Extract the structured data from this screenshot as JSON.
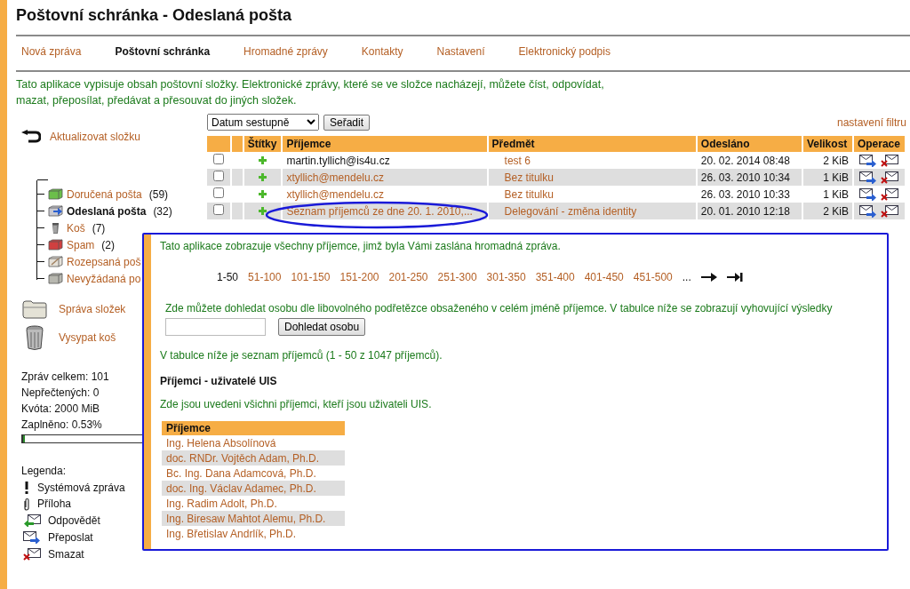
{
  "title": "Poštovní schránka - Odeslaná pošta",
  "nav": [
    {
      "label": "Nová zpráva",
      "selected": false
    },
    {
      "label": "Poštovní schránka",
      "selected": true
    },
    {
      "label": "Hromadné zprávy",
      "selected": false
    },
    {
      "label": "Kontakty",
      "selected": false
    },
    {
      "label": "Nastavení",
      "selected": false
    },
    {
      "label": "Elektronický podpis",
      "selected": false
    }
  ],
  "intro": "Tato aplikace vypisuje obsah poštovní složky. Elektronické zprávy, které se ve složce nacházejí, můžete číst, odpovídat, mazat, přeposílat, předávat a přesouvat do jiných složek.",
  "sidebar": {
    "refresh": "Aktualizovat složku",
    "folders": [
      {
        "kind": "inbox",
        "name": "Doručená pošta",
        "count": "(59)",
        "selected": false
      },
      {
        "kind": "sent",
        "name": "Odeslaná pošta",
        "count": "(32)",
        "selected": true
      },
      {
        "kind": "trash",
        "name": "Koš",
        "count": "(7)",
        "selected": false
      },
      {
        "kind": "spam",
        "name": "Spam",
        "count": "(2)",
        "selected": false
      },
      {
        "kind": "drafts",
        "name": "Rozepsaná poš",
        "selected": false
      },
      {
        "kind": "junk",
        "name": "Nevyžádaná po",
        "selected": false
      }
    ],
    "actions": [
      {
        "kind": "folder",
        "label": "Správa složek"
      },
      {
        "kind": "trash",
        "label": "Vysypat koš"
      }
    ],
    "stats": [
      "Zpráv celkem: 101",
      "Nepřečtených: 0",
      "Kvóta: 2000 MiB",
      "Zaplněno: 0.53%"
    ],
    "usage": {
      "level": 0.0053
    },
    "legend_title": "Legenda:",
    "legend": [
      {
        "kind": "system",
        "label": "Systémová zpráva"
      },
      {
        "kind": "attachment",
        "label": "Příloha"
      },
      {
        "kind": "reply",
        "label": "Odpovědět"
      },
      {
        "kind": "forward",
        "label": "Přeposlat"
      },
      {
        "kind": "delete",
        "label": "Smazat"
      }
    ]
  },
  "sort": {
    "value": "Datum sestupně",
    "button": "Seřadit"
  },
  "filter_link": "nastavení filtru",
  "table": {
    "columns": [
      "Štítky",
      "Příjemce",
      "Předmět",
      "Odesláno",
      "Velikost",
      "Operace"
    ],
    "rows": [
      {
        "checked": false,
        "recipient": "martin.tyllich@is4u.cz",
        "recipient_link": false,
        "subject": "test 6",
        "sent": "20. 02. 2014 08:48",
        "size": "2 KiB"
      },
      {
        "checked": false,
        "recipient": "xtyllich@mendelu.cz",
        "recipient_link": true,
        "subject": "Bez titulku",
        "sent": "26. 03. 2010 10:34",
        "size": "1 KiB"
      },
      {
        "checked": false,
        "recipient": "xtyllich@mendelu.cz",
        "recipient_link": true,
        "subject": "Bez titulku",
        "sent": "26. 03. 2010 10:33",
        "size": "1 KiB"
      },
      {
        "checked": false,
        "recipient": "Seznam příjemců ze dne 20. 1. 2010,...",
        "recipient_link": true,
        "subject": "Delegování - změna identity",
        "sent": "20. 01. 2010 12:18",
        "size": "2 KiB"
      }
    ]
  },
  "overlay": {
    "intro": "Tato aplikace zobrazuje všechny příjemce, jimž byla Vámi zaslána hromadná zpráva.",
    "pages": [
      {
        "label": "1-50",
        "selected": true
      },
      {
        "label": "51-100",
        "selected": false
      },
      {
        "label": "101-150",
        "selected": false
      },
      {
        "label": "151-200",
        "selected": false
      },
      {
        "label": "201-250",
        "selected": false
      },
      {
        "label": "251-300",
        "selected": false
      },
      {
        "label": "301-350",
        "selected": false
      },
      {
        "label": "351-400",
        "selected": false
      },
      {
        "label": "401-450",
        "selected": false
      },
      {
        "label": "451-500",
        "selected": false
      }
    ],
    "ellipsis": "...",
    "search_hint": "Zde můžete dohledat osobu dle libovolného podřetězce obsaženého v celém jméně příjemce. V tabulce níže se zobrazují vyhovující výsledky",
    "search_button": "Dohledat osobu",
    "summary": "V tabulce níže je seznam příjemců (1 - 50 z 1047 příjemců).",
    "heading": "Příjemci - uživatelé UIS",
    "note": "Zde jsou uvedeni všichni příjemci, kteří jsou uživateli UIS.",
    "column": "Příjemce",
    "recipients": [
      "Ing. Helena Absolínová",
      "doc. RNDr. Vojtěch Adam, Ph.D.",
      "Bc. Ing. Dana Adamcová, Ph.D.",
      "doc. Ing. Václav Adamec, Ph.D.",
      "Ing. Radim Adolt, Ph.D.",
      "Ing. Biresaw Mahtot Alemu, Ph.D.",
      "Ing. Břetislav Andrlík, Ph.D."
    ]
  }
}
